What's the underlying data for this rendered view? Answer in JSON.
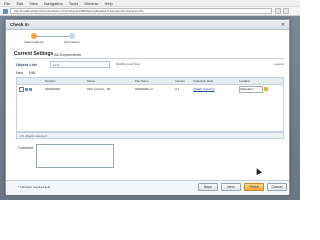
{
  "browser": {
    "menu": [
      "File",
      "Edit",
      "View",
      "Navigation",
      "Tools",
      "Window",
      "Help"
    ],
    "url": "http://localhost/tcpm/CheckIn/index.html?ObjectId=B55&showRelated=1&mode=checkin&nav=list"
  },
  "dialog": {
    "title": "Check In",
    "steps": [
      {
        "label": "Select Objects",
        "color": "#f0a53d"
      },
      {
        "label": "Set Options",
        "color": "#c9d6e3"
      }
    ],
    "section_title": "Current Settings",
    "tab_label": "All Dependents",
    "object_list_label": "Object List",
    "object_list_value": "As Is",
    "object_list_filter": "Modified and New",
    "legend_text": "Legend",
    "toolbar": [
      "New",
      "Edit"
    ],
    "columns": [
      "",
      "Number",
      "Name",
      "File Name",
      "Version",
      "Collection Rule",
      "Location"
    ],
    "rows": [
      {
        "number": "000000000",
        "name": "SKF Content - 00",
        "file_name": "00000000.prt",
        "version": "A.1",
        "rule": "Initially Selected",
        "location": "/Standard"
      }
    ],
    "status_text": "1/1 objects selected",
    "comment_label": "Comment",
    "required_note": "* Indicates required field",
    "buttons": {
      "back": "Back",
      "next": "Next",
      "finish": "Finish",
      "cancel": "Cancel"
    }
  }
}
